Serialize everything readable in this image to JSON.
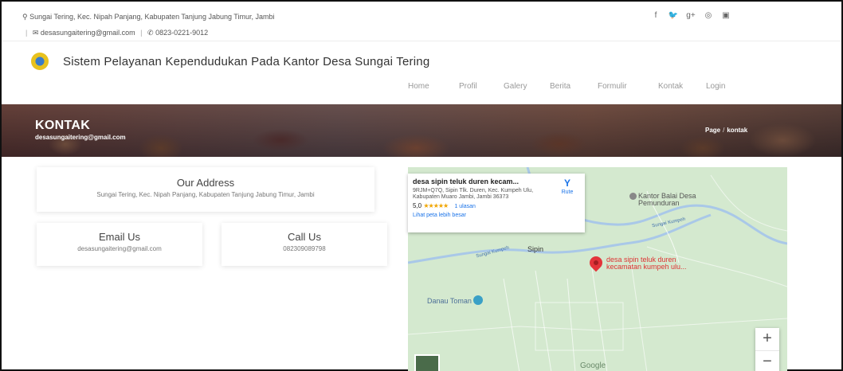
{
  "topbar": {
    "address": "Sungai Tering, Kec. Nipah Panjang, Kabupaten Tanjung Jabung Timur, Jambi",
    "email": "desasungaitering@gmail.com",
    "phone": "0823-0221-9012",
    "pin_icon": "map-marker-icon",
    "mail_icon": "envelope-icon",
    "phone_icon": "phone-icon",
    "social": [
      {
        "icon": "facebook-icon",
        "glyph": "f"
      },
      {
        "icon": "twitter-icon",
        "glyph": "🐦"
      },
      {
        "icon": "google-plus-icon",
        "glyph": "g+"
      },
      {
        "icon": "dribbble-icon",
        "glyph": "◎"
      },
      {
        "icon": "instagram-icon",
        "glyph": "▣"
      }
    ]
  },
  "header": {
    "title": "Sistem Pelayanan Kependudukan Pada Kantor Desa Sungai Tering",
    "nav": [
      "Home",
      "Profil",
      "Galery",
      "Berita",
      "Formulir",
      "Kontak",
      "Login"
    ]
  },
  "banner": {
    "title": "KONTAK",
    "subtitle": "desasungaitering@gmail.com",
    "crumb_home": "Page",
    "crumb_current": "kontak"
  },
  "contact": {
    "address_title": "Our Address",
    "address_value": "Sungai Tering, Kec. Nipah Panjang, Kabupaten Tanjung Jabung Timur, Jambi",
    "email_title": "Email Us",
    "email_value": "desasungaitering@gmail.com",
    "call_title": "Call Us",
    "call_value": "082309089798"
  },
  "map": {
    "place_name": "desa sipin teluk duren kecam...",
    "place_address": "9RJM+Q7Q, Sipin Tlk. Duren, Kec. Kumpeh Ulu, Kabupaten Muaro Jambi, Jambi 36373",
    "rating": "5,0",
    "stars": "★★★★★",
    "review_count": "1 ulasan",
    "larger_map_link": "Lihat peta lebih besar",
    "route_label": "Rute",
    "poi_office": "Kantor Balai Desa Pemunduran",
    "river_label_1": "Sungai Kumpeh",
    "river_label_2": "Sungai Kumpeh",
    "village": "Sipin",
    "pin_label": "desa sipin teluk duren kecamatan kumpeh ulu...",
    "lake": "Danau Toman",
    "zoom_in": "+",
    "zoom_out": "−",
    "google": "Google"
  }
}
